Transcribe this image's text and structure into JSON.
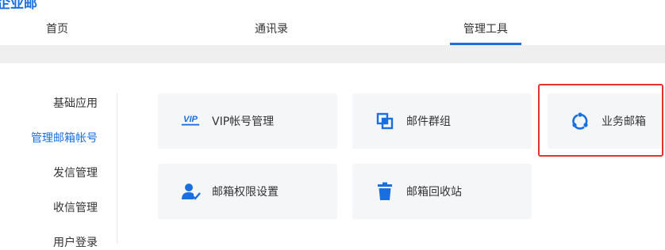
{
  "brand": {
    "title": "企业邮"
  },
  "topnav": {
    "tabs": [
      {
        "label": "首页"
      },
      {
        "label": "通讯录"
      },
      {
        "label": "管理工具"
      }
    ],
    "active_tab": "管理工具"
  },
  "sidebar": {
    "items": [
      {
        "label": "基础应用"
      },
      {
        "label": "管理邮箱帐号"
      },
      {
        "label": "发信管理"
      },
      {
        "label": "收信管理"
      },
      {
        "label": "用户登录"
      }
    ],
    "active_item": "管理邮箱帐号"
  },
  "cards": [
    {
      "label": "VIP帐号管理",
      "icon": "vip-icon",
      "icon_text": "VIP"
    },
    {
      "label": "邮件群组",
      "icon": "group-icon"
    },
    {
      "label": "业务邮箱",
      "icon": "business-mailbox-icon",
      "highlighted": true
    },
    {
      "label": "邮箱权限设置",
      "icon": "user-permission-icon"
    },
    {
      "label": "邮箱回收站",
      "icon": "trash-icon"
    }
  ],
  "colors": {
    "accent": "#1a6fe0",
    "highlight_border": "#e4332d",
    "card_bg": "#f5f6f8"
  }
}
